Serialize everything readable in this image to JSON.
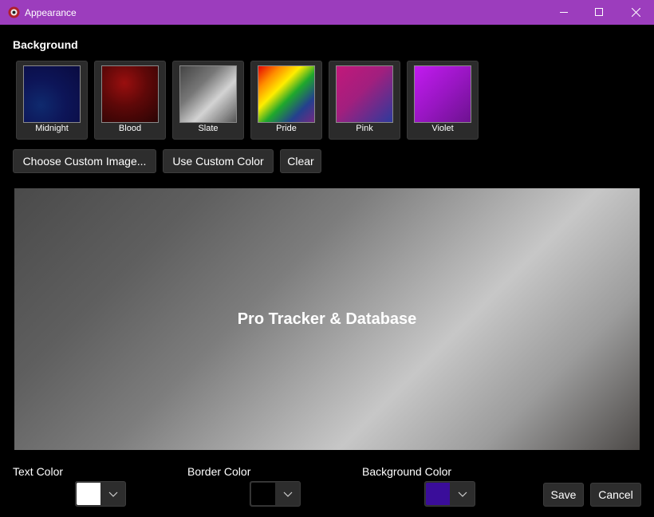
{
  "window": {
    "title": "Appearance",
    "icon": "app-logo-icon",
    "controls": [
      "minimize-icon",
      "maximize-icon",
      "close-icon"
    ],
    "accent": "#9c3dbd"
  },
  "background": {
    "heading": "Background",
    "presets": [
      {
        "label": "Midnight",
        "colors": [
          "#0f2a6e",
          "#0d0f4a"
        ]
      },
      {
        "label": "Blood",
        "colors": [
          "#8a0d0d",
          "#2a0404"
        ]
      },
      {
        "label": "Slate",
        "colors": [
          "#4a4a4a",
          "#d0d0d0"
        ]
      },
      {
        "label": "Pride",
        "colors": [
          "#e40303",
          "#ff8c00",
          "#ffed00",
          "#008026",
          "#24408e",
          "#732982"
        ]
      },
      {
        "label": "Pink",
        "colors": [
          "#c2187a",
          "#2d3a9c"
        ]
      },
      {
        "label": "Violet",
        "colors": [
          "#c21bf0",
          "#6d1290"
        ]
      }
    ],
    "buttons": {
      "choose_image": "Choose Custom Image...",
      "custom_color": "Use Custom Color",
      "clear": "Clear"
    }
  },
  "preview": {
    "text": "Pro Tracker & Database"
  },
  "colors": {
    "text_color_label": "Text Color",
    "text_color_value": "#ffffff",
    "border_color_label": "Border Color",
    "border_color_value": "#000000",
    "background_color_label": "Background Color",
    "background_color_value": "#3a0d9a"
  },
  "actions": {
    "save": "Save",
    "cancel": "Cancel"
  }
}
